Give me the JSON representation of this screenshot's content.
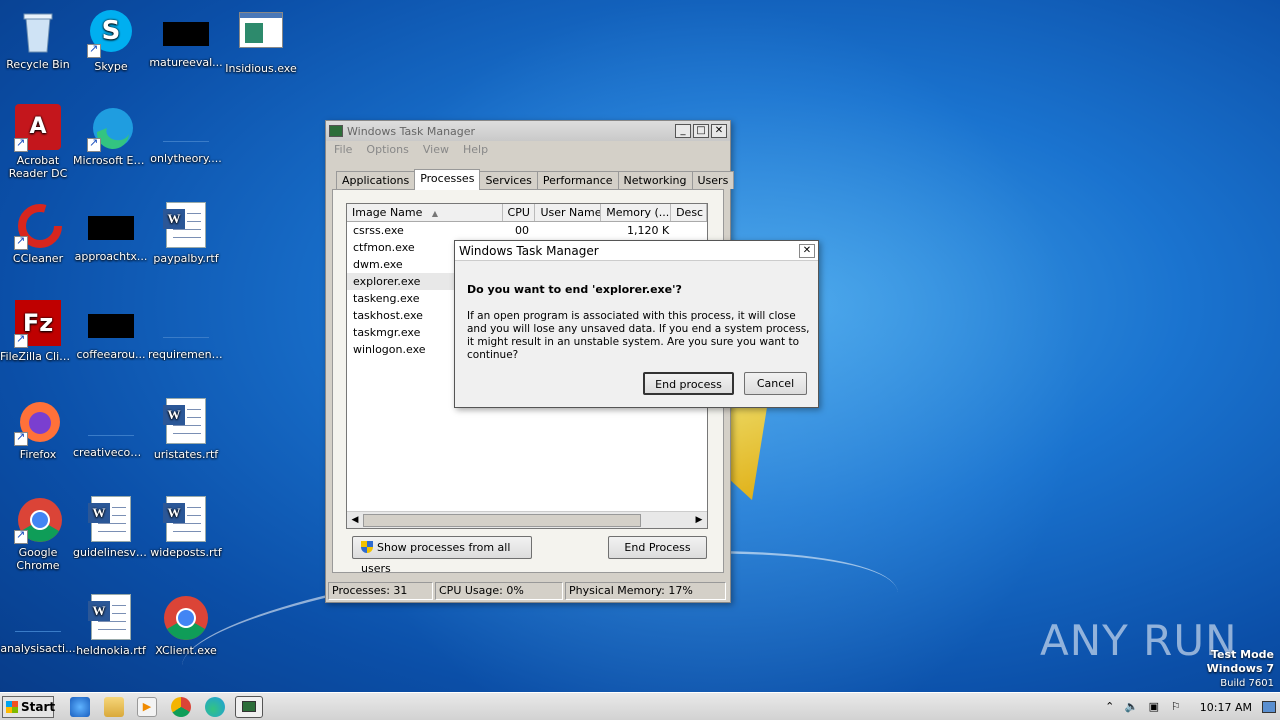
{
  "desktop": {
    "icons": [
      {
        "label": "Recycle Bin"
      },
      {
        "label": "Skype"
      },
      {
        "label": "matureeval..."
      },
      {
        "label": "Insidious.exe"
      },
      {
        "label": "Acrobat Reader DC"
      },
      {
        "label": "Microsoft Edge"
      },
      {
        "label": "onlytheory...."
      },
      {
        "label": "CCleaner"
      },
      {
        "label": "approachtx..."
      },
      {
        "label": "paypalby.rtf"
      },
      {
        "label": "FileZilla Client"
      },
      {
        "label": "coffeearou..."
      },
      {
        "label": "requirement..."
      },
      {
        "label": "Firefox"
      },
      {
        "label": "creativecom..."
      },
      {
        "label": "uristates.rtf"
      },
      {
        "label": "Google Chrome"
      },
      {
        "label": "guidelinesvi..."
      },
      {
        "label": "wideposts.rtf"
      },
      {
        "label": "analysisacti..."
      },
      {
        "label": "heldnokia.rtf"
      },
      {
        "label": "XClient.exe"
      }
    ]
  },
  "taskmanager": {
    "title": "Windows Task Manager",
    "menu": [
      "File",
      "Options",
      "View",
      "Help"
    ],
    "tabs": [
      "Applications",
      "Processes",
      "Services",
      "Performance",
      "Networking",
      "Users"
    ],
    "columns": [
      "Image Name",
      "CPU",
      "User Name",
      "Memory (...",
      "Desc"
    ],
    "rows": [
      {
        "name": "csrss.exe",
        "cpu": "00",
        "mem": "1,120 K"
      },
      {
        "name": "ctfmon.exe",
        "cpu": "",
        "mem": ""
      },
      {
        "name": "dwm.exe",
        "cpu": "",
        "mem": ""
      },
      {
        "name": "explorer.exe",
        "cpu": "",
        "mem": ""
      },
      {
        "name": "taskeng.exe",
        "cpu": "",
        "mem": ""
      },
      {
        "name": "taskhost.exe",
        "cpu": "",
        "mem": ""
      },
      {
        "name": "taskmgr.exe",
        "cpu": "",
        "mem": ""
      },
      {
        "name": "winlogon.exe",
        "cpu": "",
        "mem": ""
      }
    ],
    "show_all_label": "Show processes from all users",
    "end_process_label": "End Process",
    "status": {
      "processes": "Processes: 31",
      "cpu": "CPU Usage: 0%",
      "memory": "Physical Memory: 17%"
    }
  },
  "dialog": {
    "title": "Windows Task Manager",
    "question": "Do you want to end 'explorer.exe'?",
    "message": "If an open program is associated with this process, it will close and you will lose any unsaved data. If you end a system process, it might result in an unstable system. Are you sure you want to continue?",
    "end_label": "End process",
    "cancel_label": "Cancel"
  },
  "taskbar": {
    "start_label": "Start",
    "time": "10:17 AM"
  },
  "watermark": {
    "line1": "Test Mode",
    "line2": "Windows 7",
    "line3": "Build 7601",
    "brand": "ANY RUN"
  },
  "colors": {
    "desktop_blue": "#1a73cf",
    "window_gray": "#d4d0c8"
  }
}
